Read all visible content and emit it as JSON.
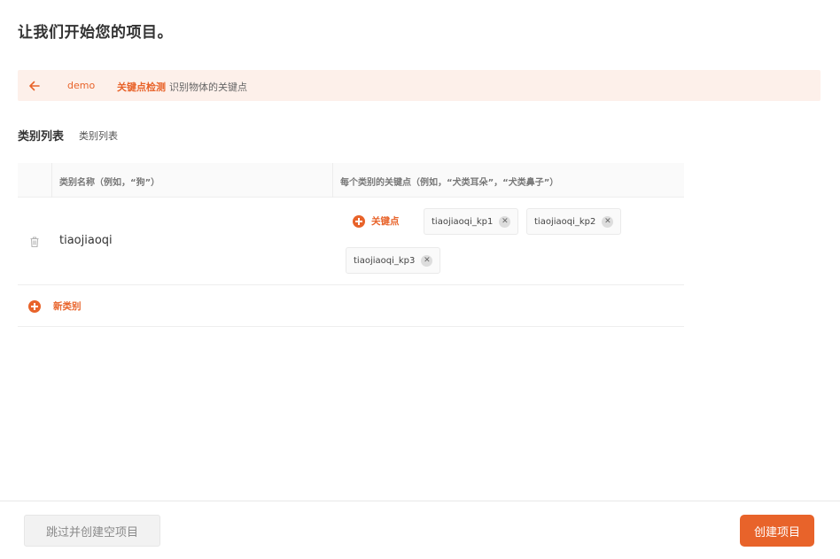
{
  "page": {
    "title": "让我们开始您的项目。"
  },
  "breadcrumb": {
    "back_icon": "arrow-left-icon",
    "project": "demo",
    "task_type": "关键点检测",
    "task_desc": "识别物体的关键点"
  },
  "section": {
    "title": "类别列表",
    "subtitle": "类别列表"
  },
  "table": {
    "headers": {
      "name": "类别名称（例如，“狗”）",
      "keypoints": "每个类别的关键点（例如，“犬类耳朵”，“犬类鼻子”）"
    },
    "rows": [
      {
        "name": "tiaojiaoqi",
        "add_keypoint_label": "关键点",
        "keypoints": [
          "tiaojiaoqi_kp1",
          "tiaojiaoqi_kp2",
          "tiaojiaoqi_kp3"
        ]
      }
    ],
    "new_category_label": "新类别"
  },
  "footer": {
    "skip_label": "跳过并创建空项目",
    "create_label": "创建项目"
  },
  "colors": {
    "accent": "#e8632a",
    "banner_bg": "#fdf0ea"
  }
}
